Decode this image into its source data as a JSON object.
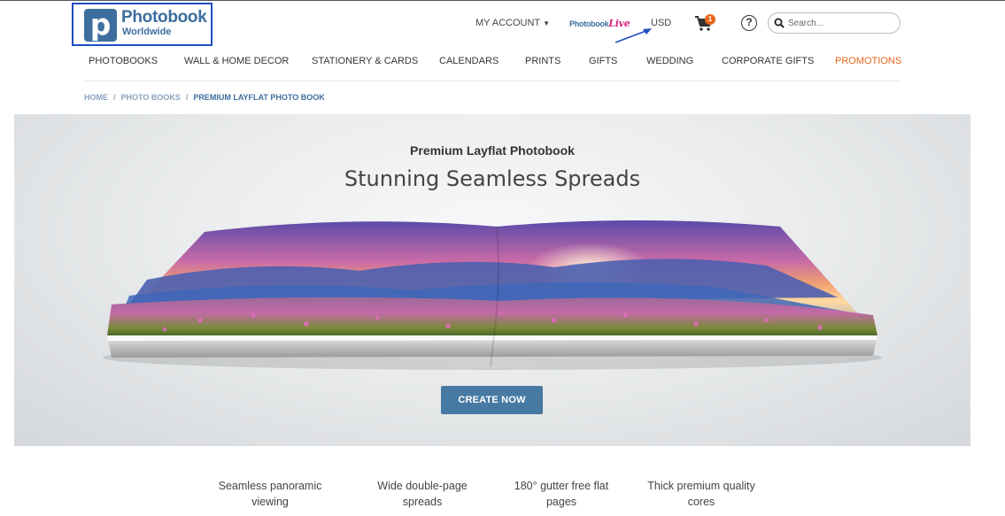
{
  "header": {
    "logo_title": "Photobook",
    "logo_sub": "Worldwide",
    "my_account": "MY ACCOUNT",
    "photobook_live_brand": "Photobook",
    "photobook_live_suffix": "Live",
    "currency": "USD",
    "cart_count": "1",
    "help_symbol": "?",
    "search_placeholder": "Search..."
  },
  "nav": {
    "items": [
      "PHOTOBOOKS",
      "WALL & HOME DECOR",
      "STATIONERY & CARDS",
      "CALENDARS",
      "PRINTS",
      "GIFTS",
      "WEDDING",
      "CORPORATE GIFTS",
      "PROMOTIONS"
    ]
  },
  "breadcrumb": {
    "home": "HOME",
    "section": "PHOTO BOOKS",
    "current": "PREMIUM LAYFLAT PHOTO BOOK",
    "separator": "/"
  },
  "hero": {
    "kicker": "Premium Layflat Photobook",
    "title": "Stunning Seamless Spreads",
    "cta": "CREATE NOW"
  },
  "features": [
    {
      "line1": "Seamless panoramic",
      "line2": "viewing"
    },
    {
      "line1": "Wide double-page",
      "line2": "spreads"
    },
    {
      "line1": "180° gutter free flat",
      "line2": "pages"
    },
    {
      "line1": "Thick premium quality",
      "line2": "cores"
    }
  ],
  "colors": {
    "brand": "#3d6e9e",
    "promo": "#e8651a",
    "cta": "#477aa3",
    "highlight_box": "#1f4fbf"
  },
  "icons": {
    "cart": "cart-icon",
    "help": "help-icon",
    "search": "search-icon"
  }
}
